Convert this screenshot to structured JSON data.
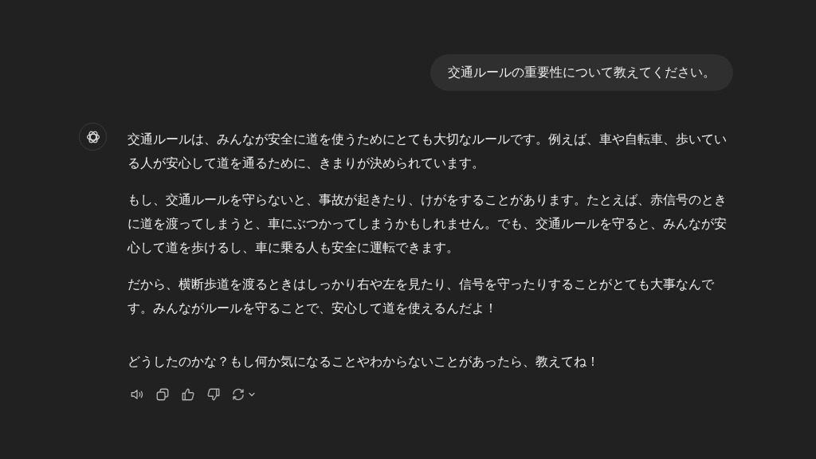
{
  "user_message": "交通ルールの重要性について教えてください。",
  "assistant_message": {
    "paragraphs": [
      "交通ルールは、みんなが安全に道を使うためにとても大切なルールです。例えば、車や自転車、歩いている人が安心して道を通るために、きまりが決められています。",
      "もし、交通ルールを守らないと、事故が起きたり、けがをすることがあります。たとえば、赤信号のときに道を渡ってしまうと、車にぶつかってしまうかもしれません。でも、交通ルールを守ると、みんなが安心して道を歩けるし、車に乗る人も安全に運転できます。",
      "だから、横断歩道を渡るときはしっかり右や左を見たり、信号を守ったりすることがとても大事なんです。みんながルールを守ることで、安心して道を使えるんだよ！",
      "どうしたのかな？もし何か気になることやわからないことがあったら、教えてね！"
    ]
  }
}
